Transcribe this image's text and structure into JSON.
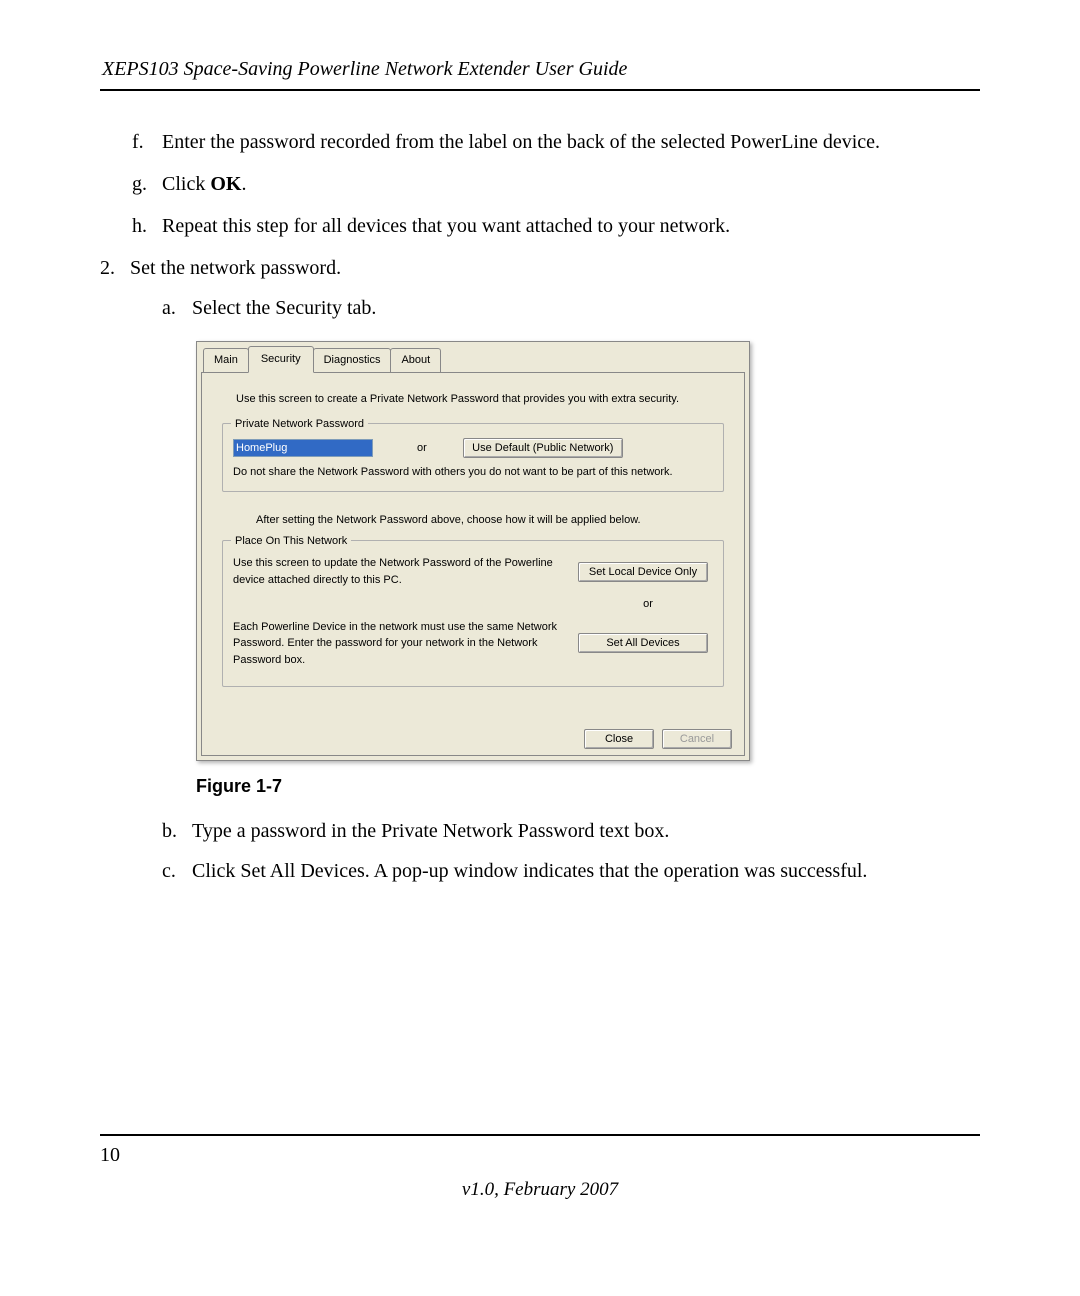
{
  "header": {
    "title": "XEPS103 Space-Saving Powerline Network Extender User Guide"
  },
  "steps": {
    "f": "Enter the password recorded from the label on the back of the selected PowerLine device.",
    "g_prefix": "Click ",
    "g_bold": "OK",
    "g_suffix": ".",
    "h": "Repeat this step for all devices that you want attached to your network.",
    "step2": "Set the network password.",
    "a": "Select the Security tab.",
    "b": "Type a password in the Private Network Password text box.",
    "c": "Click Set All Devices. A pop-up window indicates that the operation was successful."
  },
  "dialog": {
    "tabs": {
      "main": "Main",
      "security": "Security",
      "diagnostics": "Diagnostics",
      "about": "About"
    },
    "intro": "Use this screen to create a Private Network Password that provides you with extra security.",
    "group1": {
      "title": "Private Network Password",
      "input_value": "HomePlug",
      "or": "or",
      "default_btn": "Use Default (Public Network)",
      "warning": "Do not share the Network Password with others you do not want to be part of this network."
    },
    "mid_note": "After setting the Network Password above, choose how it will be applied below.",
    "group2": {
      "title": "Place On This Network",
      "local_text": "Use this screen to update the Network Password of the Powerline device attached directly to this PC.",
      "local_btn": "Set Local Device Only",
      "or": "or",
      "all_text": "Each Powerline Device in the network must use the same Network Password. Enter the password for your network in the Network Password box.",
      "all_btn": "Set All Devices"
    },
    "close": "Close",
    "cancel": "Cancel"
  },
  "figure_caption": "Figure 1-7",
  "footer": {
    "page": "10",
    "version": "v1.0, February 2007"
  }
}
